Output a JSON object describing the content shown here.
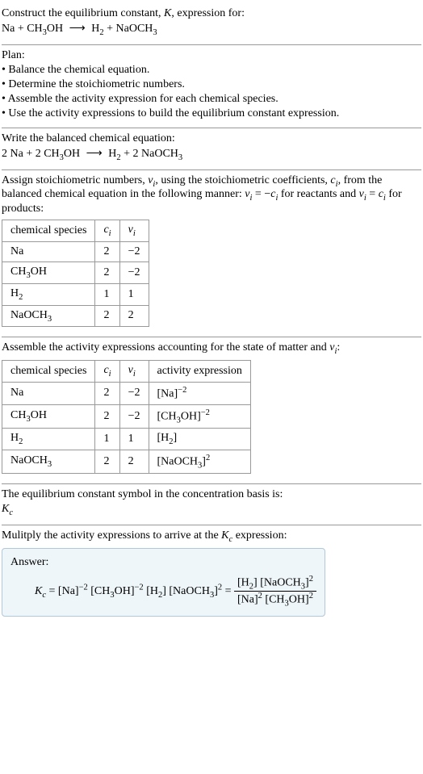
{
  "intro": {
    "title_line1": "Construct the equilibrium constant, ",
    "K": "K",
    "title_line1b": ", expression for:",
    "eq_l": "Na + CH",
    "eq_s1": "3",
    "eq_m1": "OH",
    "eq_arrow": "⟶",
    "eq_r1": "H",
    "eq_s2": "2",
    "eq_r2": " + NaOCH",
    "eq_s3": "3"
  },
  "plan": {
    "header": "Plan:",
    "b1": "• Balance the chemical equation.",
    "b2": "• Determine the stoichiometric numbers.",
    "b3": "• Assemble the activity expression for each chemical species.",
    "b4": "• Use the activity expressions to build the equilibrium constant expression."
  },
  "balanced": {
    "header": "Write the balanced chemical equation:",
    "l1": "2 Na + 2 CH",
    "s1": "3",
    "l2": "OH",
    "arrow": "⟶",
    "r1": "H",
    "s2": "2",
    "r2": " + 2 NaOCH",
    "s3": "3"
  },
  "assign": {
    "p1": "Assign stoichiometric numbers, ",
    "nu_i": "ν",
    "nu_sub": "i",
    "p2": ", using the stoichiometric coefficients, ",
    "c_i": "c",
    "c_sub": "i",
    "p3": ", from the balanced chemical equation in the following manner: ",
    "rel1a": "ν",
    "rel1b": "i",
    "rel1c": " = −",
    "rel1d": "c",
    "rel1e": "i",
    "p4": " for reactants and ",
    "rel2a": "ν",
    "rel2b": "i",
    "rel2c": " = ",
    "rel2d": "c",
    "rel2e": "i",
    "p5": " for products:"
  },
  "table1": {
    "h1": "chemical species",
    "h2_a": "c",
    "h2_b": "i",
    "h3_a": "ν",
    "h3_b": "i",
    "r1c1": "Na",
    "r1c2": "2",
    "r1c3": "−2",
    "r2c1a": "CH",
    "r2c1s": "3",
    "r2c1b": "OH",
    "r2c2": "2",
    "r2c3": "−2",
    "r3c1a": "H",
    "r3c1s": "2",
    "r3c2": "1",
    "r3c3": "1",
    "r4c1a": "NaOCH",
    "r4c1s": "3",
    "r4c2": "2",
    "r4c3": "2"
  },
  "assemble": {
    "p1": "Assemble the activity expressions accounting for the state of matter and ",
    "nu": "ν",
    "nus": "i",
    "p2": ":"
  },
  "table2": {
    "h1": "chemical species",
    "h2a": "c",
    "h2b": "i",
    "h3a": "ν",
    "h3b": "i",
    "h4": "activity expression",
    "r1c1": "Na",
    "r1c2": "2",
    "r1c3": "−2",
    "r1c4a": "[Na]",
    "r1c4s": "−2",
    "r2c1a": "CH",
    "r2c1s": "3",
    "r2c1b": "OH",
    "r2c2": "2",
    "r2c3": "−2",
    "r2c4a": "[CH",
    "r2c4s1": "3",
    "r2c4b": "OH]",
    "r2c4s2": "−2",
    "r3c1a": "H",
    "r3c1s": "2",
    "r3c2": "1",
    "r3c3": "1",
    "r3c4a": "[H",
    "r3c4s": "2",
    "r3c4b": "]",
    "r4c1a": "NaOCH",
    "r4c1s": "3",
    "r4c2": "2",
    "r4c3": "2",
    "r4c4a": "[NaOCH",
    "r4c4s1": "3",
    "r4c4b": "]",
    "r4c4s2": "2"
  },
  "symbol": {
    "p1": "The equilibrium constant symbol in the concentration basis is:",
    "K": "K",
    "Ks": "c"
  },
  "multiply": {
    "p1": "Mulitply the activity expressions to arrive at the ",
    "K": "K",
    "Ks": "c",
    "p2": " expression:"
  },
  "answer": {
    "label": "Answer:",
    "Kc_a": "K",
    "Kc_s": "c",
    "eq": " = ",
    "t1": "[Na]",
    "t1s": "−2",
    "t2a": " [CH",
    "t2s1": "3",
    "t2b": "OH]",
    "t2s2": "−2",
    "t3a": " [H",
    "t3s": "2",
    "t3b": "]",
    "t4a": " [NaOCH",
    "t4s1": "3",
    "t4b": "]",
    "t4s2": "2",
    "eq2": " = ",
    "num1a": "[H",
    "num1s": "2",
    "num1b": "]",
    "num2a": " [NaOCH",
    "num2s1": "3",
    "num2b": "]",
    "num2s2": "2",
    "den1a": "[Na]",
    "den1s": "2",
    "den2a": " [CH",
    "den2s1": "3",
    "den2b": "OH]",
    "den2s2": "2"
  },
  "chart_data": {
    "type": "table",
    "tables": [
      {
        "title": "Stoichiometric numbers",
        "columns": [
          "chemical species",
          "c_i",
          "nu_i"
        ],
        "rows": [
          [
            "Na",
            2,
            -2
          ],
          [
            "CH3OH",
            2,
            -2
          ],
          [
            "H2",
            1,
            1
          ],
          [
            "NaOCH3",
            2,
            2
          ]
        ]
      },
      {
        "title": "Activity expressions",
        "columns": [
          "chemical species",
          "c_i",
          "nu_i",
          "activity expression"
        ],
        "rows": [
          [
            "Na",
            2,
            -2,
            "[Na]^-2"
          ],
          [
            "CH3OH",
            2,
            -2,
            "[CH3OH]^-2"
          ],
          [
            "H2",
            1,
            1,
            "[H2]"
          ],
          [
            "NaOCH3",
            2,
            2,
            "[NaOCH3]^2"
          ]
        ]
      }
    ]
  }
}
